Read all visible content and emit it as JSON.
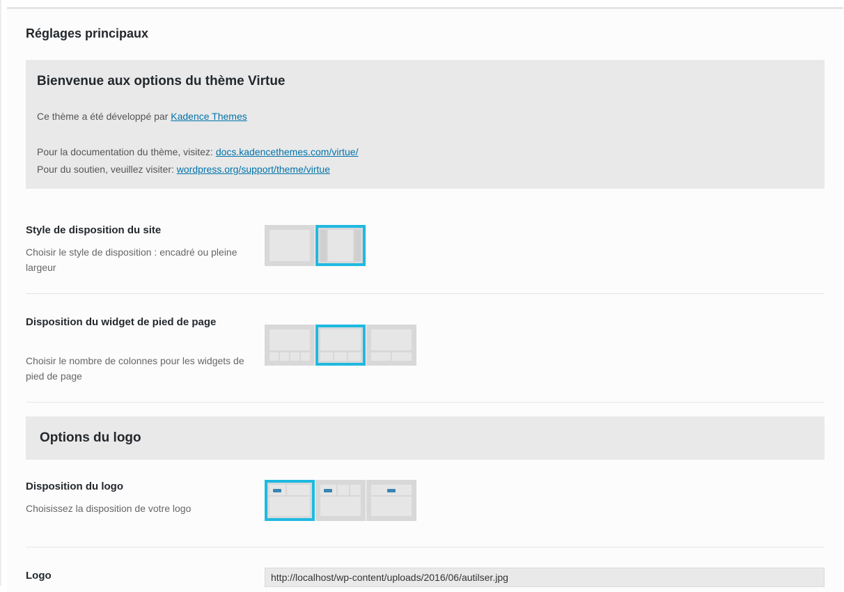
{
  "section": {
    "title": "Réglages principaux"
  },
  "welcome": {
    "title": "Bienvenue aux options du thème Virtue",
    "developed_prefix": "Ce thème a été développé par ",
    "developed_link": "Kadence Themes",
    "docs_prefix": "Pour la documentation du thème, visitez: ",
    "docs_link": "docs.kadencethemes.com/virtue/",
    "support_prefix": "Pour du soutien, veuillez visiter: ",
    "support_link": "wordpress.org/support/theme/virtue"
  },
  "site_layout": {
    "label": "Style de disposition du site",
    "description": "Choisir le style de disposition : encadré ou pleine largeur",
    "selected_index": 1
  },
  "footer_layout": {
    "label": "Disposition du widget de pied de page",
    "description": "Choisir le nombre de colonnes pour les widgets de pied de page",
    "selected_index": 1
  },
  "logo_options": {
    "title": "Options du logo"
  },
  "logo_layout": {
    "label": "Disposition du logo",
    "description": "Choisissez la disposition de votre logo",
    "selected_index": 0
  },
  "logo": {
    "label": "Logo",
    "url": "http://localhost/wp-content/uploads/2016/06/autilser.jpg"
  },
  "colors": {
    "accent": "#1eb9e1",
    "link": "#0073aa",
    "option_bg": "#d8d8d8"
  }
}
